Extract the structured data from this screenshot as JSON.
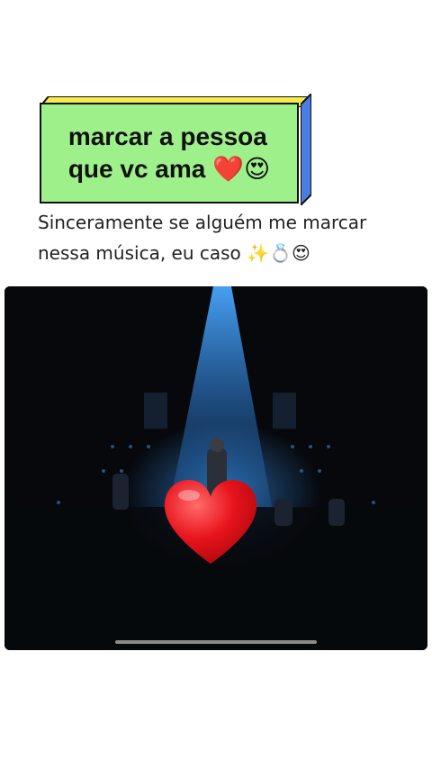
{
  "sticker": {
    "line1": "marcar a pessoa",
    "line2": "que vc ama",
    "line2_emoji": "❤️😍",
    "front_color": "#9ef08a",
    "top_color": "#f7ec4b",
    "side_color": "#4a7de0"
  },
  "caption": {
    "line1": "Sinceramente se alguém me marcar",
    "line2": "nessa música, eu caso",
    "line2_emoji": "✨💍😍"
  },
  "video": {
    "overlay_icon": "red-heart-icon",
    "progress_bar_color": "#8a8a8a"
  }
}
